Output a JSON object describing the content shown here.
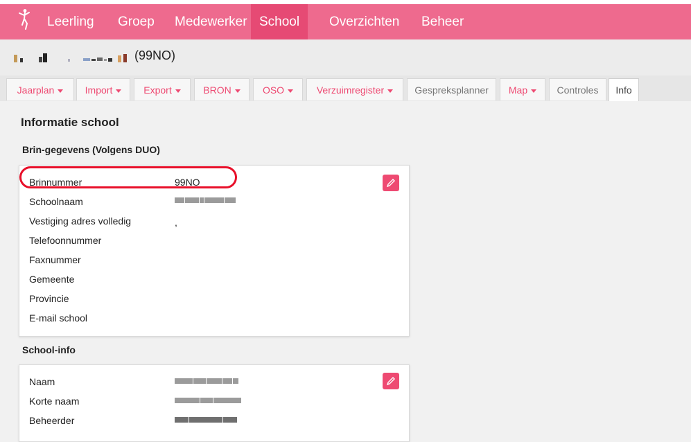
{
  "colors": {
    "brand": "#ee6a8e",
    "active_nav": "#e64a74",
    "tab_text": "#ee4a72",
    "highlight": "#e8102a"
  },
  "nav": {
    "logo_icon": "dancer-logo-icon",
    "items": [
      "Leerling",
      "Groep",
      "Medewerker",
      "School",
      "Overzichten",
      "Beheer"
    ],
    "active": "School"
  },
  "school": {
    "code": "(99NO)"
  },
  "tabs": [
    {
      "label": "Jaarplan",
      "dropdown": true
    },
    {
      "label": "Import",
      "dropdown": true
    },
    {
      "label": "Export",
      "dropdown": true
    },
    {
      "label": "BRON",
      "dropdown": true
    },
    {
      "label": "OSO",
      "dropdown": true
    },
    {
      "label": "Verzuimregister",
      "dropdown": true
    },
    {
      "label": "Gespreksplanner",
      "dropdown": false
    },
    {
      "label": "Map",
      "dropdown": true
    },
    {
      "label": "Controles",
      "dropdown": false
    },
    {
      "label": "Info",
      "dropdown": false,
      "active": true
    }
  ],
  "page": {
    "title": "Informatie school"
  },
  "brin": {
    "heading": "Brin-gegevens (Volgens DUO)",
    "rows": [
      {
        "label": "Brinnummer",
        "value": "99NO"
      },
      {
        "label": "Schoolnaam",
        "value": ""
      },
      {
        "label": "Vestiging adres volledig",
        "value": ","
      },
      {
        "label": "Telefoonnummer",
        "value": ""
      },
      {
        "label": "Faxnummer",
        "value": ""
      },
      {
        "label": "Gemeente",
        "value": ""
      },
      {
        "label": "Provincie",
        "value": ""
      },
      {
        "label": "E-mail school",
        "value": ""
      }
    ]
  },
  "schoolinfo": {
    "heading": "School-info",
    "rows": [
      {
        "label": "Naam",
        "value": ""
      },
      {
        "label": "Korte naam",
        "value": ""
      },
      {
        "label": "Beheerder",
        "value": ""
      }
    ]
  }
}
